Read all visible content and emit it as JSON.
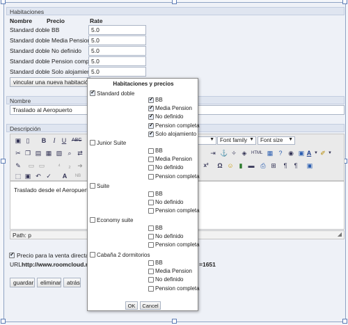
{
  "habitaciones": {
    "section_title": "Habitaciones",
    "col_nombre": "Nombre",
    "col_precio": "Precio",
    "col_rate": "Rate",
    "rows": [
      {
        "name": "Standard doble BB",
        "rate": "5.0"
      },
      {
        "name": "Standard doble Media Pension",
        "rate": "5.0"
      },
      {
        "name": "Standard doble No definido",
        "rate": "5.0"
      },
      {
        "name": "Standard doble Pension completa",
        "rate": "5.0"
      },
      {
        "name": "Standard doble Solo alojamiento",
        "rate": "5.0"
      }
    ],
    "link_button": "vincular una nueva habitación y p"
  },
  "nombre": {
    "section_title": "Nombre",
    "value": "Traslado al Aeropuerto"
  },
  "descripcion": {
    "section_title": "Descripción",
    "font_family": "Font family",
    "font_size": "Font size",
    "html_label": "HTML",
    "content": "Traslado desde el Aeropuerto al",
    "path": "Path: p"
  },
  "venta": {
    "label": "Precio para la venta directa",
    "checked": true
  },
  "url": {
    "label": "URL:",
    "value": "http://www.roomcloud.net",
    "tail": "=1651"
  },
  "buttons": {
    "guardar": "guardar",
    "eliminar": "eliminar",
    "atras": "atrás"
  },
  "dialog": {
    "title": "Habitaciones y precios",
    "groups": [
      {
        "name": "Standard doble",
        "checked": true,
        "options": [
          {
            "label": "BB",
            "checked": true
          },
          {
            "label": "Media Pension",
            "checked": true
          },
          {
            "label": "No definido",
            "checked": true
          },
          {
            "label": "Pension completa",
            "checked": true
          },
          {
            "label": "Solo alojamiento",
            "checked": true
          }
        ]
      },
      {
        "name": "Junior Suite",
        "checked": false,
        "options": [
          {
            "label": "BB",
            "checked": false
          },
          {
            "label": "Media Pension",
            "checked": false
          },
          {
            "label": "No definido",
            "checked": false
          },
          {
            "label": "Pension completa",
            "checked": false
          }
        ]
      },
      {
        "name": "Suite",
        "checked": false,
        "options": [
          {
            "label": "BB",
            "checked": false
          },
          {
            "label": "No definido",
            "checked": false
          },
          {
            "label": "Pension completa",
            "checked": false
          }
        ]
      },
      {
        "name": "Economy suite",
        "checked": false,
        "options": [
          {
            "label": "BB",
            "checked": false
          },
          {
            "label": "No definido",
            "checked": false
          },
          {
            "label": "Pension completa",
            "checked": false
          }
        ]
      },
      {
        "name": "Cabaña 2 dormitorios",
        "checked": false,
        "options": [
          {
            "label": "BB",
            "checked": false
          },
          {
            "label": "Media Pension",
            "checked": false
          },
          {
            "label": "No definido",
            "checked": false
          },
          {
            "label": "Pension completa",
            "checked": false
          }
        ]
      }
    ],
    "ok": "OK",
    "cancel": "Cancel"
  },
  "colors": {
    "accent": "#5b7bb5",
    "section_bg": "#dfe5f0",
    "page_bg": "#eef1f7"
  }
}
